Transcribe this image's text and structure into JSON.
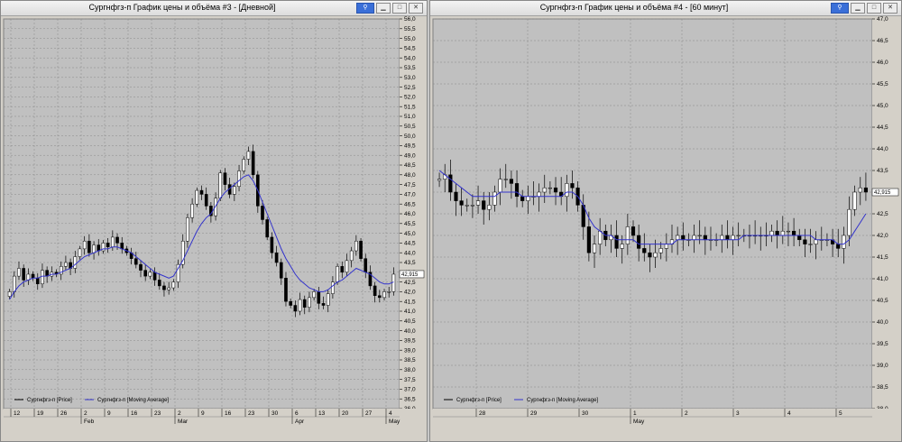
{
  "left": {
    "title": "Сургнфгз-п График цены и объёма #3 - [Дневной]",
    "pin_icon": "pin-icon",
    "legend": [
      {
        "label": "Сургнфгз-п [Price]",
        "color": "#000000"
      },
      {
        "label": "Сургнфгз-п [Moving Average]",
        "color": "#3333cc"
      }
    ],
    "price_label": "42,915",
    "x_ticks": [
      {
        "label": "12",
        "month": ""
      },
      {
        "label": "19",
        "month": ""
      },
      {
        "label": "26",
        "month": ""
      },
      {
        "label": "2",
        "month": "Feb"
      },
      {
        "label": "9",
        "month": ""
      },
      {
        "label": "16",
        "month": ""
      },
      {
        "label": "23",
        "month": ""
      },
      {
        "label": "2",
        "month": "Mar"
      },
      {
        "label": "9",
        "month": ""
      },
      {
        "label": "16",
        "month": ""
      },
      {
        "label": "23",
        "month": ""
      },
      {
        "label": "30",
        "month": ""
      },
      {
        "label": "6",
        "month": "Apr"
      },
      {
        "label": "13",
        "month": ""
      },
      {
        "label": "20",
        "month": ""
      },
      {
        "label": "27",
        "month": ""
      },
      {
        "label": "4",
        "month": "May"
      }
    ]
  },
  "right": {
    "title": "Сургнфгз-п График цены и объёма #4 - [60 минут]",
    "pin_icon": "pin-icon",
    "legend": [
      {
        "label": "Сургнфгз-п [Price]",
        "color": "#000000"
      },
      {
        "label": "Сургнфгз-п [Moving Average]",
        "color": "#3333cc"
      }
    ],
    "price_label": "42,915",
    "x_ticks": [
      {
        "label": "28",
        "month": ""
      },
      {
        "label": "29",
        "month": ""
      },
      {
        "label": "30",
        "month": ""
      },
      {
        "label": "1",
        "month": "May"
      },
      {
        "label": "2",
        "month": ""
      },
      {
        "label": "3",
        "month": ""
      },
      {
        "label": "4",
        "month": ""
      },
      {
        "label": "5",
        "month": ""
      }
    ]
  },
  "chart_data": [
    {
      "type": "candlestick",
      "title": "Сургнфгз-п График цены и объёма #3 - [Дневной]",
      "ylim": [
        36.0,
        56.0
      ],
      "y_tick_step": 0.5,
      "series": [
        {
          "name": "Сургнфгз-п [Price]",
          "close": [
            42.0,
            42.8,
            43.2,
            42.6,
            42.9,
            42.7,
            42.4,
            43.1,
            42.8,
            43.0,
            42.9,
            43.3,
            43.5,
            43.2,
            43.8,
            44.2,
            44.6,
            44.0,
            44.4,
            44.1,
            44.5,
            44.3,
            44.8,
            44.5,
            44.2,
            44.0,
            43.7,
            43.4,
            43.1,
            42.8,
            43.0,
            42.6,
            42.3,
            42.1,
            42.2,
            42.5,
            43.4,
            44.6,
            45.8,
            46.5,
            47.2,
            47.0,
            46.4,
            45.9,
            46.8,
            48.1,
            47.5,
            47.0,
            47.4,
            48.2,
            48.8,
            49.2,
            48.0,
            46.4,
            45.7,
            44.8,
            44.0,
            43.5,
            42.7,
            41.5,
            41.3,
            41.0,
            41.6,
            41.2,
            41.7,
            42.0,
            41.4,
            41.3,
            41.9,
            42.5,
            43.3,
            43.0,
            43.6,
            44.1,
            44.6,
            43.7,
            43.0,
            42.3,
            41.8,
            41.7,
            42.0,
            42.0,
            42.9
          ]
        },
        {
          "name": "Сургнфгз-п [Moving Average]",
          "values": [
            41.6,
            42.0,
            42.3,
            42.5,
            42.6,
            42.7,
            42.7,
            42.8,
            42.8,
            42.9,
            42.9,
            43.0,
            43.1,
            43.2,
            43.4,
            43.6,
            43.8,
            43.9,
            44.0,
            44.1,
            44.2,
            44.2,
            44.3,
            44.3,
            44.2,
            44.1,
            44.0,
            43.8,
            43.6,
            43.4,
            43.2,
            43.0,
            42.9,
            42.8,
            42.7,
            42.8,
            43.2,
            43.6,
            44.1,
            44.6,
            45.1,
            45.5,
            45.8,
            46.0,
            46.4,
            46.8,
            47.1,
            47.3,
            47.5,
            47.7,
            47.9,
            48.0,
            47.7,
            47.2,
            46.6,
            46.0,
            45.4,
            44.8,
            44.2,
            43.7,
            43.3,
            42.9,
            42.6,
            42.4,
            42.2,
            42.1,
            42.0,
            42.0,
            42.1,
            42.3,
            42.5,
            42.6,
            42.8,
            43.0,
            43.2,
            43.1,
            43.0,
            42.9,
            42.7,
            42.5,
            42.4,
            42.4,
            42.5
          ]
        }
      ]
    },
    {
      "type": "candlestick",
      "title": "Сургнфгз-п График цены и объёма #4 - [60 минут]",
      "ylim": [
        38.0,
        47.0
      ],
      "y_tick_step": 0.5,
      "series": [
        {
          "name": "Сургнфгз-п [Price]",
          "close": [
            43.3,
            43.4,
            43.0,
            42.8,
            42.7,
            42.7,
            42.7,
            42.8,
            42.6,
            42.7,
            43.0,
            43.3,
            43.3,
            43.2,
            42.9,
            42.8,
            42.9,
            42.9,
            43.0,
            43.1,
            43.1,
            43.0,
            42.9,
            43.2,
            43.1,
            42.7,
            42.2,
            41.6,
            41.8,
            42.1,
            41.9,
            42.0,
            41.7,
            41.8,
            42.2,
            42.0,
            41.7,
            41.6,
            41.5,
            41.6,
            41.7,
            41.8,
            41.9,
            42.0,
            41.9,
            41.9,
            42.0,
            42.0,
            41.9,
            41.9,
            41.9,
            42.0,
            41.9,
            42.0,
            42.0,
            42.0,
            42.0,
            42.0,
            42.0,
            42.0,
            42.1,
            42.0,
            42.1,
            42.1,
            42.0,
            41.9,
            41.8,
            41.8,
            41.9,
            41.9,
            41.9,
            41.8,
            41.7,
            42.0,
            42.6,
            43.0,
            43.1,
            43.0
          ]
        },
        {
          "name": "Сургнфгз-п [Moving Average]",
          "values": [
            43.5,
            43.4,
            43.3,
            43.2,
            43.1,
            43.0,
            42.9,
            42.9,
            42.9,
            42.9,
            42.9,
            43.0,
            43.0,
            43.0,
            43.0,
            42.9,
            42.9,
            42.9,
            42.9,
            42.9,
            42.9,
            42.9,
            42.9,
            43.0,
            43.0,
            42.9,
            42.7,
            42.4,
            42.2,
            42.1,
            42.0,
            42.0,
            41.9,
            41.9,
            41.9,
            41.9,
            41.8,
            41.8,
            41.8,
            41.8,
            41.8,
            41.8,
            41.8,
            41.9,
            41.9,
            41.9,
            41.9,
            41.9,
            41.9,
            41.9,
            41.9,
            41.9,
            41.9,
            41.9,
            41.9,
            42.0,
            42.0,
            42.0,
            42.0,
            42.0,
            42.0,
            42.0,
            42.0,
            42.0,
            42.0,
            42.0,
            42.0,
            42.0,
            41.9,
            41.9,
            41.9,
            41.9,
            41.8,
            41.8,
            41.9,
            42.1,
            42.3,
            42.5
          ]
        }
      ]
    }
  ]
}
